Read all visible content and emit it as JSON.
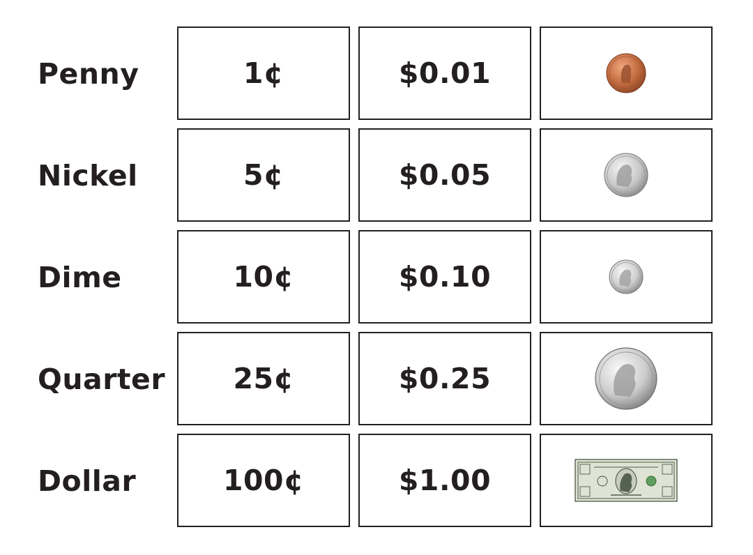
{
  "coins": [
    {
      "name": "Penny",
      "cents": "1¢",
      "dollars": "$0.01",
      "icon": "penny-coin-icon"
    },
    {
      "name": "Nickel",
      "cents": "5¢",
      "dollars": "$0.05",
      "icon": "nickel-coin-icon"
    },
    {
      "name": "Dime",
      "cents": "10¢",
      "dollars": "$0.10",
      "icon": "dime-coin-icon"
    },
    {
      "name": "Quarter",
      "cents": "25¢",
      "dollars": "$0.25",
      "icon": "quarter-coin-icon"
    },
    {
      "name": "Dollar",
      "cents": "100¢",
      "dollars": "$1.00",
      "icon": "dollar-bill-icon"
    }
  ],
  "colors": {
    "penny": "#c26a3f",
    "silver": "#c9c9c9",
    "bill": "#dfe3d4",
    "border": "#231f20"
  }
}
